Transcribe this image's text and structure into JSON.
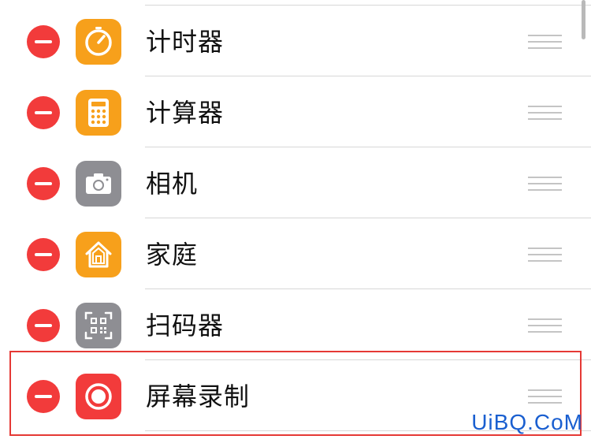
{
  "rows": [
    {
      "label": "计时器",
      "icon": "timer-icon",
      "icon_color": "#f7a01b"
    },
    {
      "label": "计算器",
      "icon": "calculator-icon",
      "icon_color": "#f7a01b"
    },
    {
      "label": "相机",
      "icon": "camera-icon",
      "icon_color": "#8e8e93"
    },
    {
      "label": "家庭",
      "icon": "home-icon",
      "icon_color": "#f7a01b"
    },
    {
      "label": "扫码器",
      "icon": "qr-scanner-icon",
      "icon_color": "#8e8e93"
    },
    {
      "label": "屏幕录制",
      "icon": "screen-recording-icon",
      "icon_color": "#f23b3b"
    }
  ],
  "colors": {
    "remove_button": "#f23b3b",
    "highlight": "#e53935",
    "watermark": "#1a5fd0"
  },
  "watermark": "UiBQ.CoM"
}
